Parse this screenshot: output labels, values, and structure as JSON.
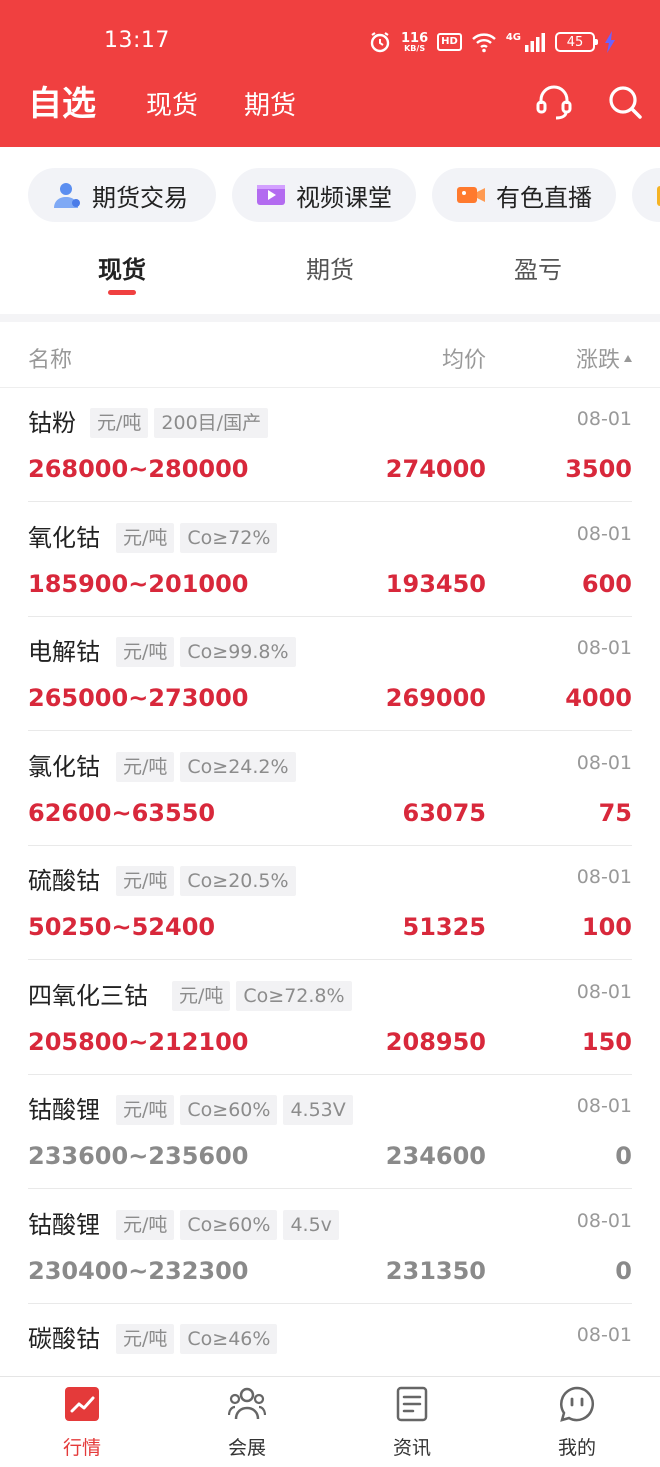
{
  "status_bar": {
    "time": "13:17",
    "net_speed": "116",
    "net_unit": "KB/S",
    "hd_badge": "HD",
    "signal_label": "4G",
    "battery": "45"
  },
  "nav": {
    "title": "自选",
    "tabs": [
      "现货",
      "期货"
    ],
    "icons": [
      "headset-icon",
      "search-icon"
    ]
  },
  "shortcuts": [
    {
      "label": "期货交易",
      "icon": "person-icon"
    },
    {
      "label": "视频课堂",
      "icon": "video-icon"
    },
    {
      "label": "有色直播",
      "icon": "camera-icon"
    },
    {
      "label": "",
      "icon": "folder-icon"
    }
  ],
  "subtabs": {
    "items": [
      "现货",
      "期货",
      "盈亏"
    ],
    "active": 0
  },
  "table": {
    "headers": {
      "name": "名称",
      "avg": "均价",
      "change": "涨跌"
    },
    "rows": [
      {
        "name": "钴粉",
        "tags": [
          "元/吨",
          "200目/国产"
        ],
        "date": "08-01",
        "range": "268000~280000",
        "avg": "274000",
        "change": "3500",
        "trend": "up"
      },
      {
        "name": "氧化钴",
        "tags": [
          "元/吨",
          "Co≥72%"
        ],
        "date": "08-01",
        "range": "185900~201000",
        "avg": "193450",
        "change": "600",
        "trend": "up"
      },
      {
        "name": "电解钴",
        "tags": [
          "元/吨",
          "Co≥99.8%"
        ],
        "date": "08-01",
        "range": "265000~273000",
        "avg": "269000",
        "change": "4000",
        "trend": "up"
      },
      {
        "name": "氯化钴",
        "tags": [
          "元/吨",
          "Co≥24.2%"
        ],
        "date": "08-01",
        "range": "62600~63550",
        "avg": "63075",
        "change": "75",
        "trend": "up"
      },
      {
        "name": "硫酸钴",
        "tags": [
          "元/吨",
          "Co≥20.5%"
        ],
        "date": "08-01",
        "range": "50250~52400",
        "avg": "51325",
        "change": "100",
        "trend": "up"
      },
      {
        "name": "四氧化三钴",
        "tags": [
          "元/吨",
          "Co≥72.8%"
        ],
        "date": "08-01",
        "range": "205800~212100",
        "avg": "208950",
        "change": "150",
        "trend": "up"
      },
      {
        "name": "钴酸锂",
        "tags": [
          "元/吨",
          "Co≥60%",
          "4.53V"
        ],
        "date": "08-01",
        "range": "233600~235600",
        "avg": "234600",
        "change": "0",
        "trend": "flat"
      },
      {
        "name": "钴酸锂",
        "tags": [
          "元/吨",
          "Co≥60%",
          "4.5v"
        ],
        "date": "08-01",
        "range": "230400~232300",
        "avg": "231350",
        "change": "0",
        "trend": "flat"
      },
      {
        "name": "碳酸钴",
        "tags": [
          "元/吨",
          "Co≥46%"
        ],
        "date": "08-01",
        "range": "",
        "avg": "",
        "change": "",
        "trend": "up"
      }
    ]
  },
  "bottom_tabs": [
    {
      "label": "行情",
      "icon": "chart-icon",
      "active": true
    },
    {
      "label": "会展",
      "icon": "people-icon",
      "active": false
    },
    {
      "label": "资讯",
      "icon": "news-icon",
      "active": false
    },
    {
      "label": "我的",
      "icon": "profile-icon",
      "active": false
    }
  ],
  "colors": {
    "brand_red": "#f04040",
    "price_up": "#d8283b",
    "price_flat": "#8a8a8a",
    "chip_bg": "#f2f3f7"
  }
}
